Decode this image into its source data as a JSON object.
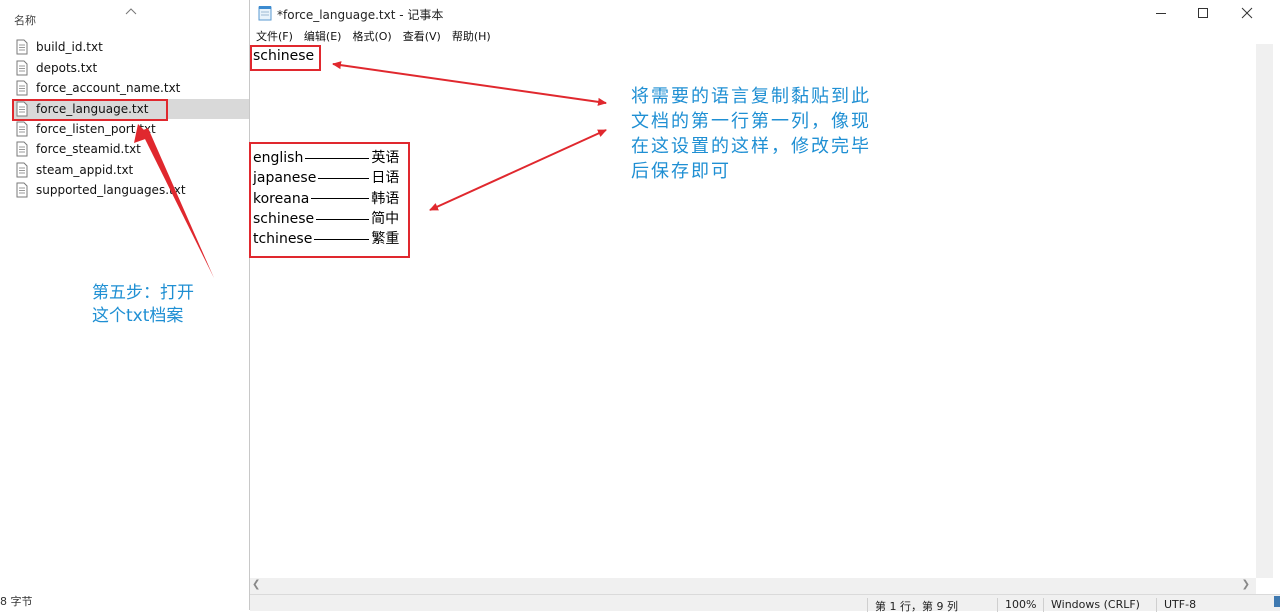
{
  "explorer": {
    "column_header": "名称",
    "files": [
      {
        "name": "build_id.txt"
      },
      {
        "name": "depots.txt"
      },
      {
        "name": "force_account_name.txt"
      },
      {
        "name": "force_language.txt",
        "selected": true
      },
      {
        "name": "force_listen_port.txt"
      },
      {
        "name": "force_steamid.txt"
      },
      {
        "name": "steam_appid.txt"
      },
      {
        "name": "supported_languages.txt"
      }
    ],
    "status_text": "8 字节"
  },
  "notepad": {
    "title": "*force_language.txt - 记事本",
    "menu": [
      "文件(F)",
      "编辑(E)",
      "格式(O)",
      "查看(V)",
      "帮助(H)"
    ],
    "editor_text": "schinese",
    "status": {
      "position": "第 1 行，第 9 列",
      "zoom": "100%",
      "line_ending": "Windows (CRLF)",
      "encoding": "UTF-8"
    }
  },
  "annotations": {
    "languages": [
      {
        "code": "english",
        "name": "英语"
      },
      {
        "code": "japanese",
        "name": "日语"
      },
      {
        "code": "koreana",
        "name": "韩语"
      },
      {
        "code": "schinese",
        "name": "简中"
      },
      {
        "code": "tchinese",
        "name": "繁重"
      }
    ],
    "step_note": [
      "第五步：打开",
      "这个txt档案"
    ],
    "main_note": [
      "将需要的语言复制黏贴到此",
      "文档的第一行第一列，像现",
      "在这设置的这样，修改完毕",
      "后保存即可"
    ],
    "colors": {
      "box": "#e0282e",
      "text": "#1f8fd3"
    }
  }
}
